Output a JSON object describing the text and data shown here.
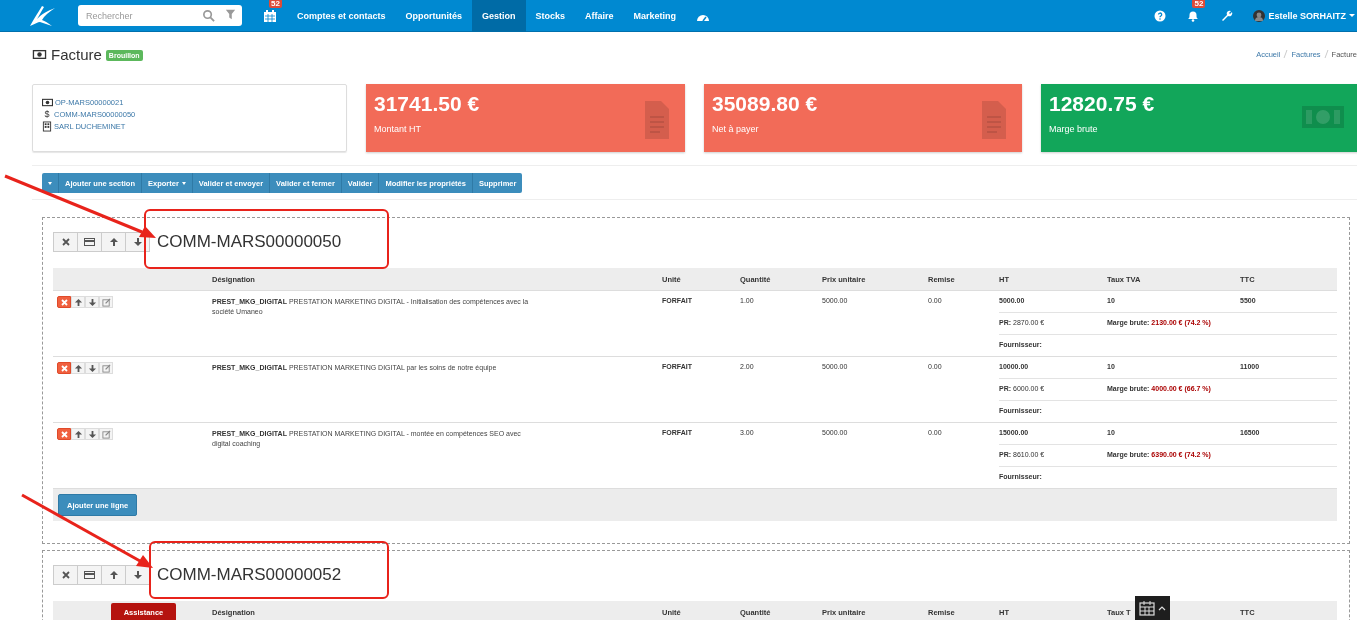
{
  "navbar": {
    "search": {
      "placeholder": "Rechercher"
    },
    "calendar_badge": "52",
    "menu": [
      {
        "label": "Comptes et contacts",
        "selected": false
      },
      {
        "label": "Opportunités",
        "selected": false
      },
      {
        "label": "Gestion",
        "selected": true
      },
      {
        "label": "Stocks",
        "selected": false
      },
      {
        "label": "Affaire",
        "selected": false
      },
      {
        "label": "Marketing",
        "selected": false
      }
    ],
    "notifications_badge": "52",
    "user": "Estelle SORHAITZ"
  },
  "page": {
    "title": "Facture",
    "status": "Brouillon",
    "breadcrumb": [
      "Accueil",
      "Factures",
      "Facture"
    ]
  },
  "info": [
    {
      "kind": "banknote",
      "text": "OP-MARS00000021"
    },
    {
      "kind": "glyph",
      "glyph": "$",
      "text": "COMM-MARS00000050"
    },
    {
      "kind": "building",
      "text": "SARL DUCHEMINET"
    }
  ],
  "stats": [
    {
      "value": "31741.50 €",
      "label": "Montant HT",
      "kind": "document",
      "color": "#f26b58"
    },
    {
      "value": "35089.80 €",
      "label": "Net à payer",
      "kind": "document",
      "color": "#f26b58"
    },
    {
      "value": "12820.75 €",
      "label": "Marge brute",
      "kind": "money",
      "color": "#12a65a"
    }
  ],
  "toolbar": [
    {
      "kind": "caret"
    },
    {
      "kind": "button",
      "label": "Ajouter une section"
    },
    {
      "kind": "dropdown",
      "label": "Exporter"
    },
    {
      "kind": "button",
      "label": "Valider et envoyer"
    },
    {
      "kind": "button",
      "label": "Valider et fermer"
    },
    {
      "kind": "button",
      "label": "Valider"
    },
    {
      "kind": "button",
      "label": "Modifier les propriétés"
    },
    {
      "kind": "button",
      "label": "Supprimer"
    }
  ],
  "sections": [
    {
      "title": "COMM-MARS00000050",
      "columns": [
        "Désignation",
        "Unité",
        "Quantité",
        "Prix unitaire",
        "Remise",
        "HT",
        "Taux TVA",
        "TTC"
      ],
      "lines": [
        {
          "designation": "**PREST_MKG_DIGITAL** PRESTATION MARKETING DIGITAL - Initialisation des compétences avec la société Umaneo",
          "unit": "FORFAIT",
          "quantity": "1.00",
          "price": "5000.00",
          "discount": "0.00",
          "ht": "5000.00",
          "vat": "10",
          "ttc": "5500",
          "pr_label": "PR:",
          "pr": "2870.00 €",
          "margin_label": "Marge brute:",
          "margin": "2130.00 € (74.2 %)",
          "supplier_label": "Fournisseur:"
        },
        {
          "designation": "**PREST_MKG_DIGITAL** PRESTATION MARKETING DIGITAL par les soins de notre équipe",
          "unit": "FORFAIT",
          "quantity": "2.00",
          "price": "5000.00",
          "discount": "0.00",
          "ht": "10000.00",
          "vat": "10",
          "ttc": "11000",
          "pr_label": "PR:",
          "pr": "6000.00 €",
          "margin_label": "Marge brute:",
          "margin": "4000.00 € (66.7 %)",
          "supplier_label": "Fournisseur:"
        },
        {
          "designation": "**PREST_MKG_DIGITAL** PRESTATION MARKETING DIGITAL - montée en compétences SEO avec digital coaching",
          "unit": "FORFAIT",
          "quantity": "3.00",
          "price": "5000.00",
          "discount": "0.00",
          "ht": "15000.00",
          "vat": "10",
          "ttc": "16500",
          "pr_label": "PR:",
          "pr": "8610.00 €",
          "margin_label": "Marge brute:",
          "margin": "6390.00 € (74.2 %)",
          "supplier_label": "Fournisseur:"
        }
      ],
      "add_line": "Ajouter une ligne"
    },
    {
      "title": "COMM-MARS00000052",
      "columns": [
        "Désignation",
        "Unité",
        "Quantité",
        "Prix unitaire",
        "Remise",
        "HT",
        "Taux T",
        "TTC"
      ]
    }
  ],
  "assistance_button": "Assistance"
}
